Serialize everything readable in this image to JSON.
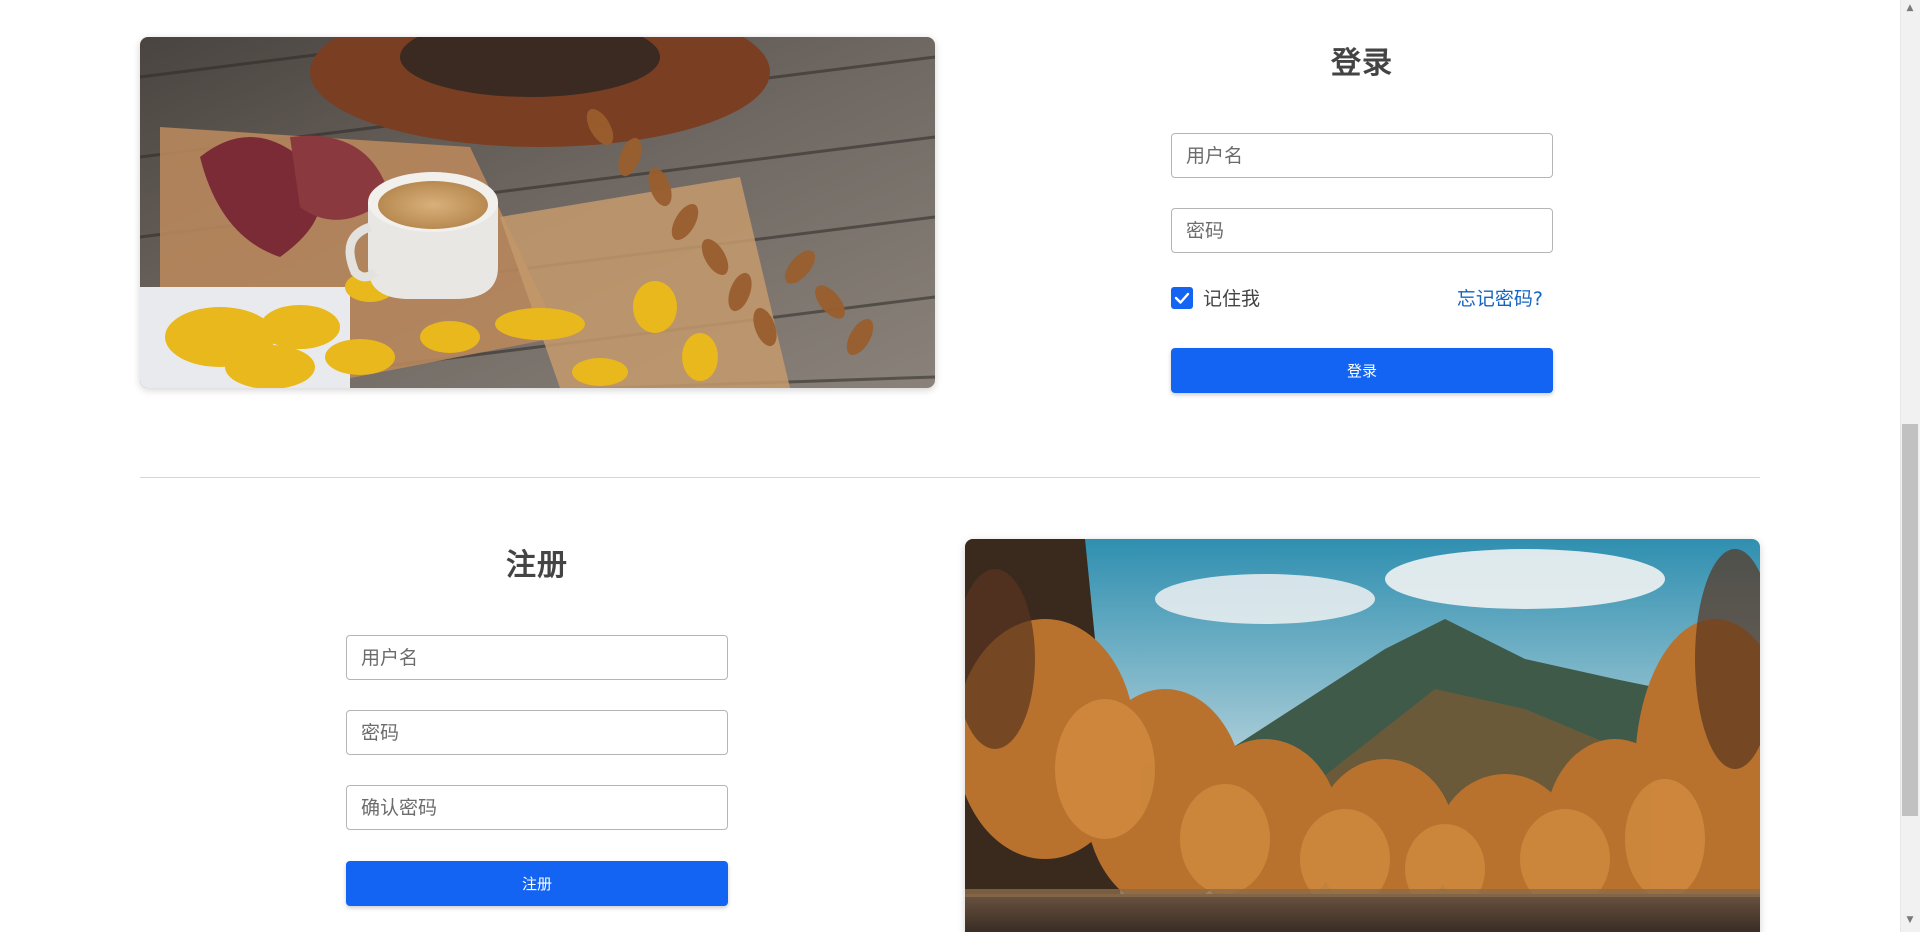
{
  "login": {
    "title": "登录",
    "username_placeholder": "用户名",
    "password_placeholder": "密码",
    "remember_me_label": "记住我",
    "remember_me_checked": true,
    "forgot_password_label": "忘记密码?",
    "submit_label": "登录"
  },
  "register": {
    "title": "注册",
    "username_placeholder": "用户名",
    "password_placeholder": "密码",
    "confirm_password_placeholder": "确认密码",
    "submit_label": "注册"
  },
  "images": {
    "top": "coffee-autumn-leaves-photo",
    "bottom": "autumn-forest-mountain-river-photo"
  },
  "colors": {
    "primary": "#1464f4",
    "link": "#1565c0",
    "title_text": "#444444",
    "divider": "#d6d6d6"
  },
  "scrollbar": {
    "up_icon": "chevron-up-icon",
    "down_icon": "chevron-down-icon"
  }
}
